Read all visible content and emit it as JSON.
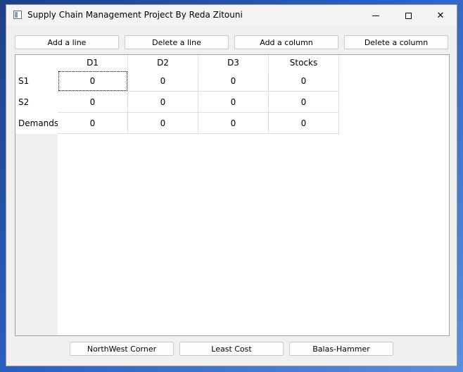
{
  "window": {
    "title": "Supply Chain Management Project By Reda Zitouni"
  },
  "caption": {
    "minimize": "",
    "maximize": "",
    "close": "✕"
  },
  "toolbar": {
    "add_line": "Add a line",
    "delete_line": "Delete a line",
    "add_column": "Add a column",
    "delete_column": "Delete a column"
  },
  "table": {
    "columns": [
      "D1",
      "D2",
      "D3",
      "Stocks"
    ],
    "rows": [
      {
        "label": "S1",
        "cells": [
          "0",
          "0",
          "0",
          "0"
        ]
      },
      {
        "label": "S2",
        "cells": [
          "0",
          "0",
          "0",
          "0"
        ]
      },
      {
        "label": "Demands",
        "cells": [
          "0",
          "0",
          "0",
          "0"
        ]
      }
    ]
  },
  "actions": {
    "northwest": "NorthWest Corner",
    "least_cost": "Least Cost",
    "balas_hammer": "Balas-Hammer"
  }
}
